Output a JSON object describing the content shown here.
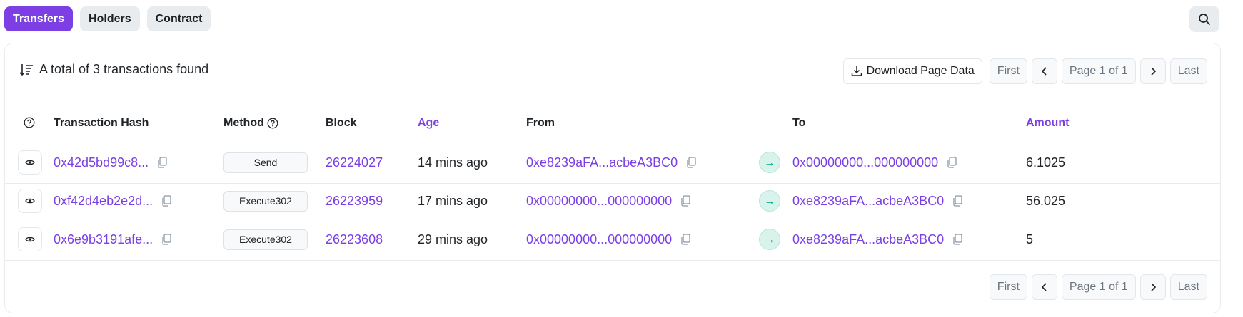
{
  "tabs": [
    {
      "label": "Transfers",
      "active": true
    },
    {
      "label": "Holders",
      "active": false
    },
    {
      "label": "Contract",
      "active": false
    }
  ],
  "summary": {
    "text": "A total of 3 transactions found"
  },
  "toolbar": {
    "download_label": "Download Page Data",
    "first_label": "First",
    "page_label": "Page 1 of 1",
    "last_label": "Last"
  },
  "columns": {
    "hash": "Transaction Hash",
    "method": "Method",
    "block": "Block",
    "age": "Age",
    "from": "From",
    "to": "To",
    "amount": "Amount"
  },
  "rows": [
    {
      "hash": "0x42d5bd99c8...",
      "method": "Send",
      "block": "26224027",
      "age": "14 mins ago",
      "from": "0xe8239aFA...acbeA3BC0",
      "to": "0x00000000...000000000",
      "amount": "6.1025"
    },
    {
      "hash": "0xf42d4eb2e2d...",
      "method": "Execute302",
      "block": "26223959",
      "age": "17 mins ago",
      "from": "0x00000000...000000000",
      "to": "0xe8239aFA...acbeA3BC0",
      "amount": "56.025"
    },
    {
      "hash": "0x6e9b3191afe...",
      "method": "Execute302",
      "block": "26223608",
      "age": "29 mins ago",
      "from": "0x00000000...000000000",
      "to": "0xe8239aFA...acbeA3BC0",
      "amount": "5"
    }
  ],
  "colors": {
    "accent": "#7b3fe4",
    "arrow": "#00a186"
  },
  "icons": [
    "search-icon",
    "sort-icon",
    "download-icon",
    "chevron-left-icon",
    "chevron-right-icon",
    "help-circle-icon",
    "eye-icon",
    "copy-icon",
    "arrow-right-icon"
  ]
}
